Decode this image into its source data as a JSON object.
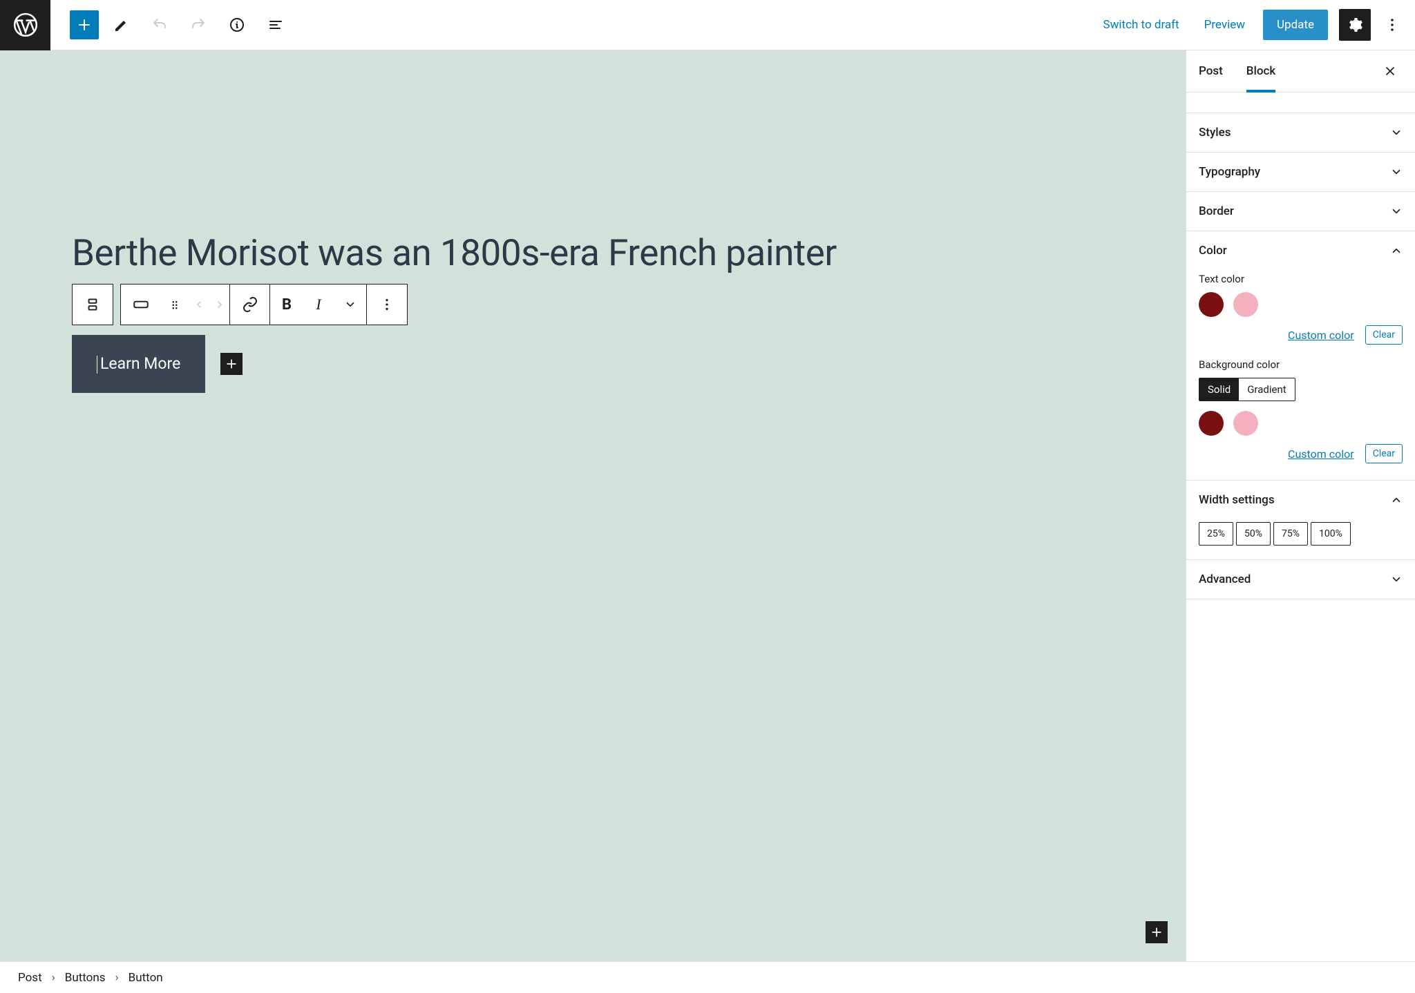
{
  "topbar": {
    "switch_to_draft": "Switch to draft",
    "preview": "Preview",
    "update": "Update"
  },
  "editor": {
    "title": "Berthe Morisot was an 1800s-era French painter",
    "button_label": "Learn More"
  },
  "sidebar": {
    "tabs": {
      "post": "Post",
      "block": "Block"
    },
    "panels": {
      "styles": "Styles",
      "typography": "Typography",
      "border": "Border",
      "color": "Color",
      "width": "Width settings",
      "advanced": "Advanced"
    },
    "color": {
      "text_label": "Text color",
      "bg_label": "Background color",
      "custom": "Custom color",
      "clear": "Clear",
      "solid": "Solid",
      "gradient": "Gradient",
      "swatches": {
        "dark": "#7b1013",
        "light": "#f3b1c0"
      }
    },
    "width_options": [
      "25%",
      "50%",
      "75%",
      "100%"
    ]
  },
  "breadcrumb": [
    "Post",
    "Buttons",
    "Button"
  ]
}
